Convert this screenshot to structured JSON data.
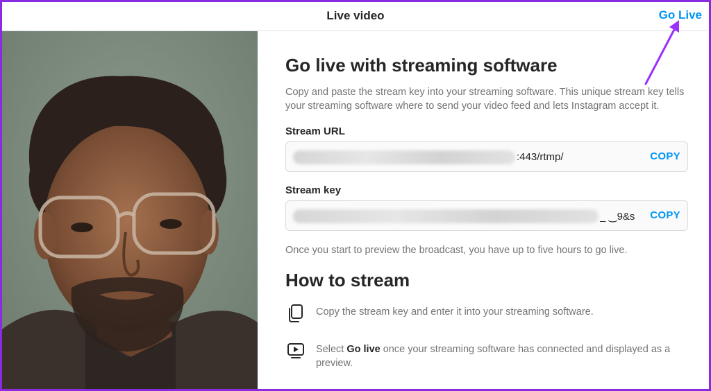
{
  "header": {
    "title": "Live video",
    "go_live_label": "Go Live"
  },
  "colors": {
    "accent": "#0095f6",
    "annotation": "#9b30ff",
    "border": "#8a2be2"
  },
  "main": {
    "section_title": "Go live with streaming software",
    "description": "Copy and paste the stream key into your streaming software. This unique stream key tells your streaming software where to send your video feed and lets Instagram accept it.",
    "stream_url": {
      "label": "Stream URL",
      "value_visible": ":443/rtmp/",
      "copy_label": "COPY"
    },
    "stream_key": {
      "label": "Stream key",
      "value_visible": "_ ‿9&s",
      "copy_label": "COPY"
    },
    "note": "Once you start to preview the broadcast, you have up to five hours to go live.",
    "how_title": "How to stream",
    "steps": [
      {
        "icon": "copy-icon",
        "text": "Copy the stream key and enter it into your streaming software."
      },
      {
        "icon": "screen-play-icon",
        "text_before": "Select ",
        "text_bold": "Go live",
        "text_after": " once your streaming software has connected and displayed as a preview."
      }
    ]
  }
}
